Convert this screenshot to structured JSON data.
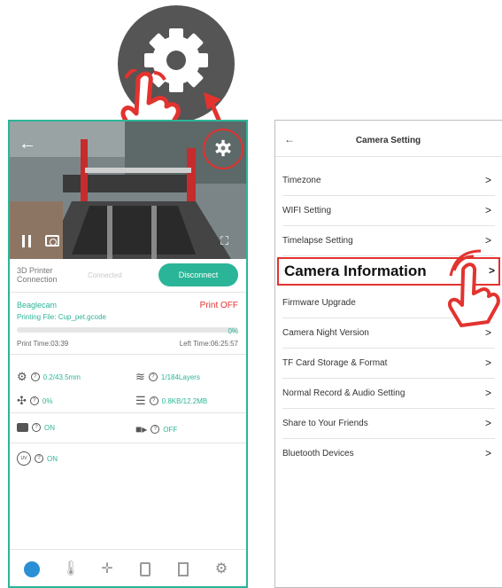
{
  "left": {
    "status_label": "3D Printer\nConnection",
    "status_value": "Connected",
    "disconnect_label": "Disconnect",
    "cam_name": "Beaglecam",
    "print_state": "Print OFF",
    "printing_file_label": "Printing File:",
    "printing_file_value": "Cup_pet.gcode",
    "progress_percent": 0,
    "progress_text": "0%",
    "print_time": "Print Time:03:39",
    "left_time": "Left Time:06:25:57",
    "stats": {
      "z_height": "0.2/43.5mm",
      "layers": "1/184Layers",
      "fan": "0%",
      "storage": "0.8KB/12.2MB",
      "camera_state": "ON",
      "record_state": "OFF",
      "uv_state": "ON"
    }
  },
  "right": {
    "title": "Camera Setting",
    "items": [
      {
        "label": "Timezone"
      },
      {
        "label": "WIFI Setting"
      },
      {
        "label": "Timelapse Setting"
      },
      {
        "label": "Camera Information"
      },
      {
        "label": "Firmware Upgrade"
      },
      {
        "label": "Camera Night Version"
      },
      {
        "label": "TF Card Storage & Format"
      },
      {
        "label": "Normal Record & Audio Setting"
      },
      {
        "label": "Share to Your Friends"
      },
      {
        "label": "Bluetooth Devices"
      }
    ]
  },
  "colors": {
    "accent": "#2bb598",
    "highlight": "#e2332f",
    "gear_circle": "#555555"
  }
}
